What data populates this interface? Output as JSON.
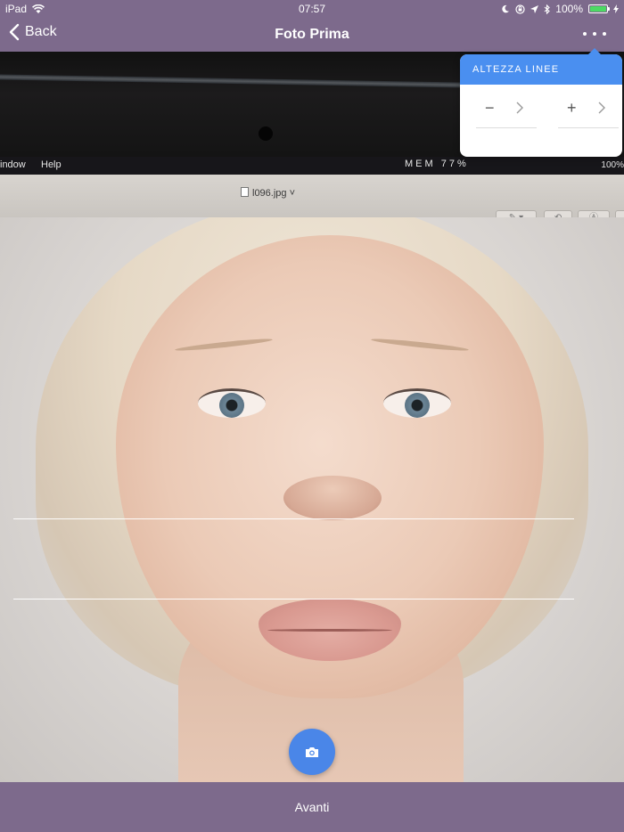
{
  "status_bar": {
    "device": "iPad",
    "time": "07:57",
    "battery": "100%",
    "battery_level": 1.0
  },
  "nav": {
    "back_label": "Back",
    "title": "Foto Prima"
  },
  "popover": {
    "title": "ALTEZZA LINEE",
    "minus": "−",
    "plus": "+"
  },
  "camera_scene": {
    "menu_window": "indow",
    "menu_help": "Help",
    "menubar_status": "MEM 77%",
    "menubar_battery": "100%",
    "document_title": "l096.jpg"
  },
  "bottom": {
    "next_label": "Avanti"
  },
  "colors": {
    "bar": "#7d6a8c",
    "accent": "#4a8ff0",
    "capture": "#4a86e8"
  },
  "icons": [
    "wifi-icon",
    "moon-icon",
    "lock-rotation-icon",
    "location-icon",
    "bluetooth-icon",
    "battery-icon",
    "chevron-left-icon",
    "more-icon",
    "chevron-right-icon",
    "camera-icon"
  ]
}
